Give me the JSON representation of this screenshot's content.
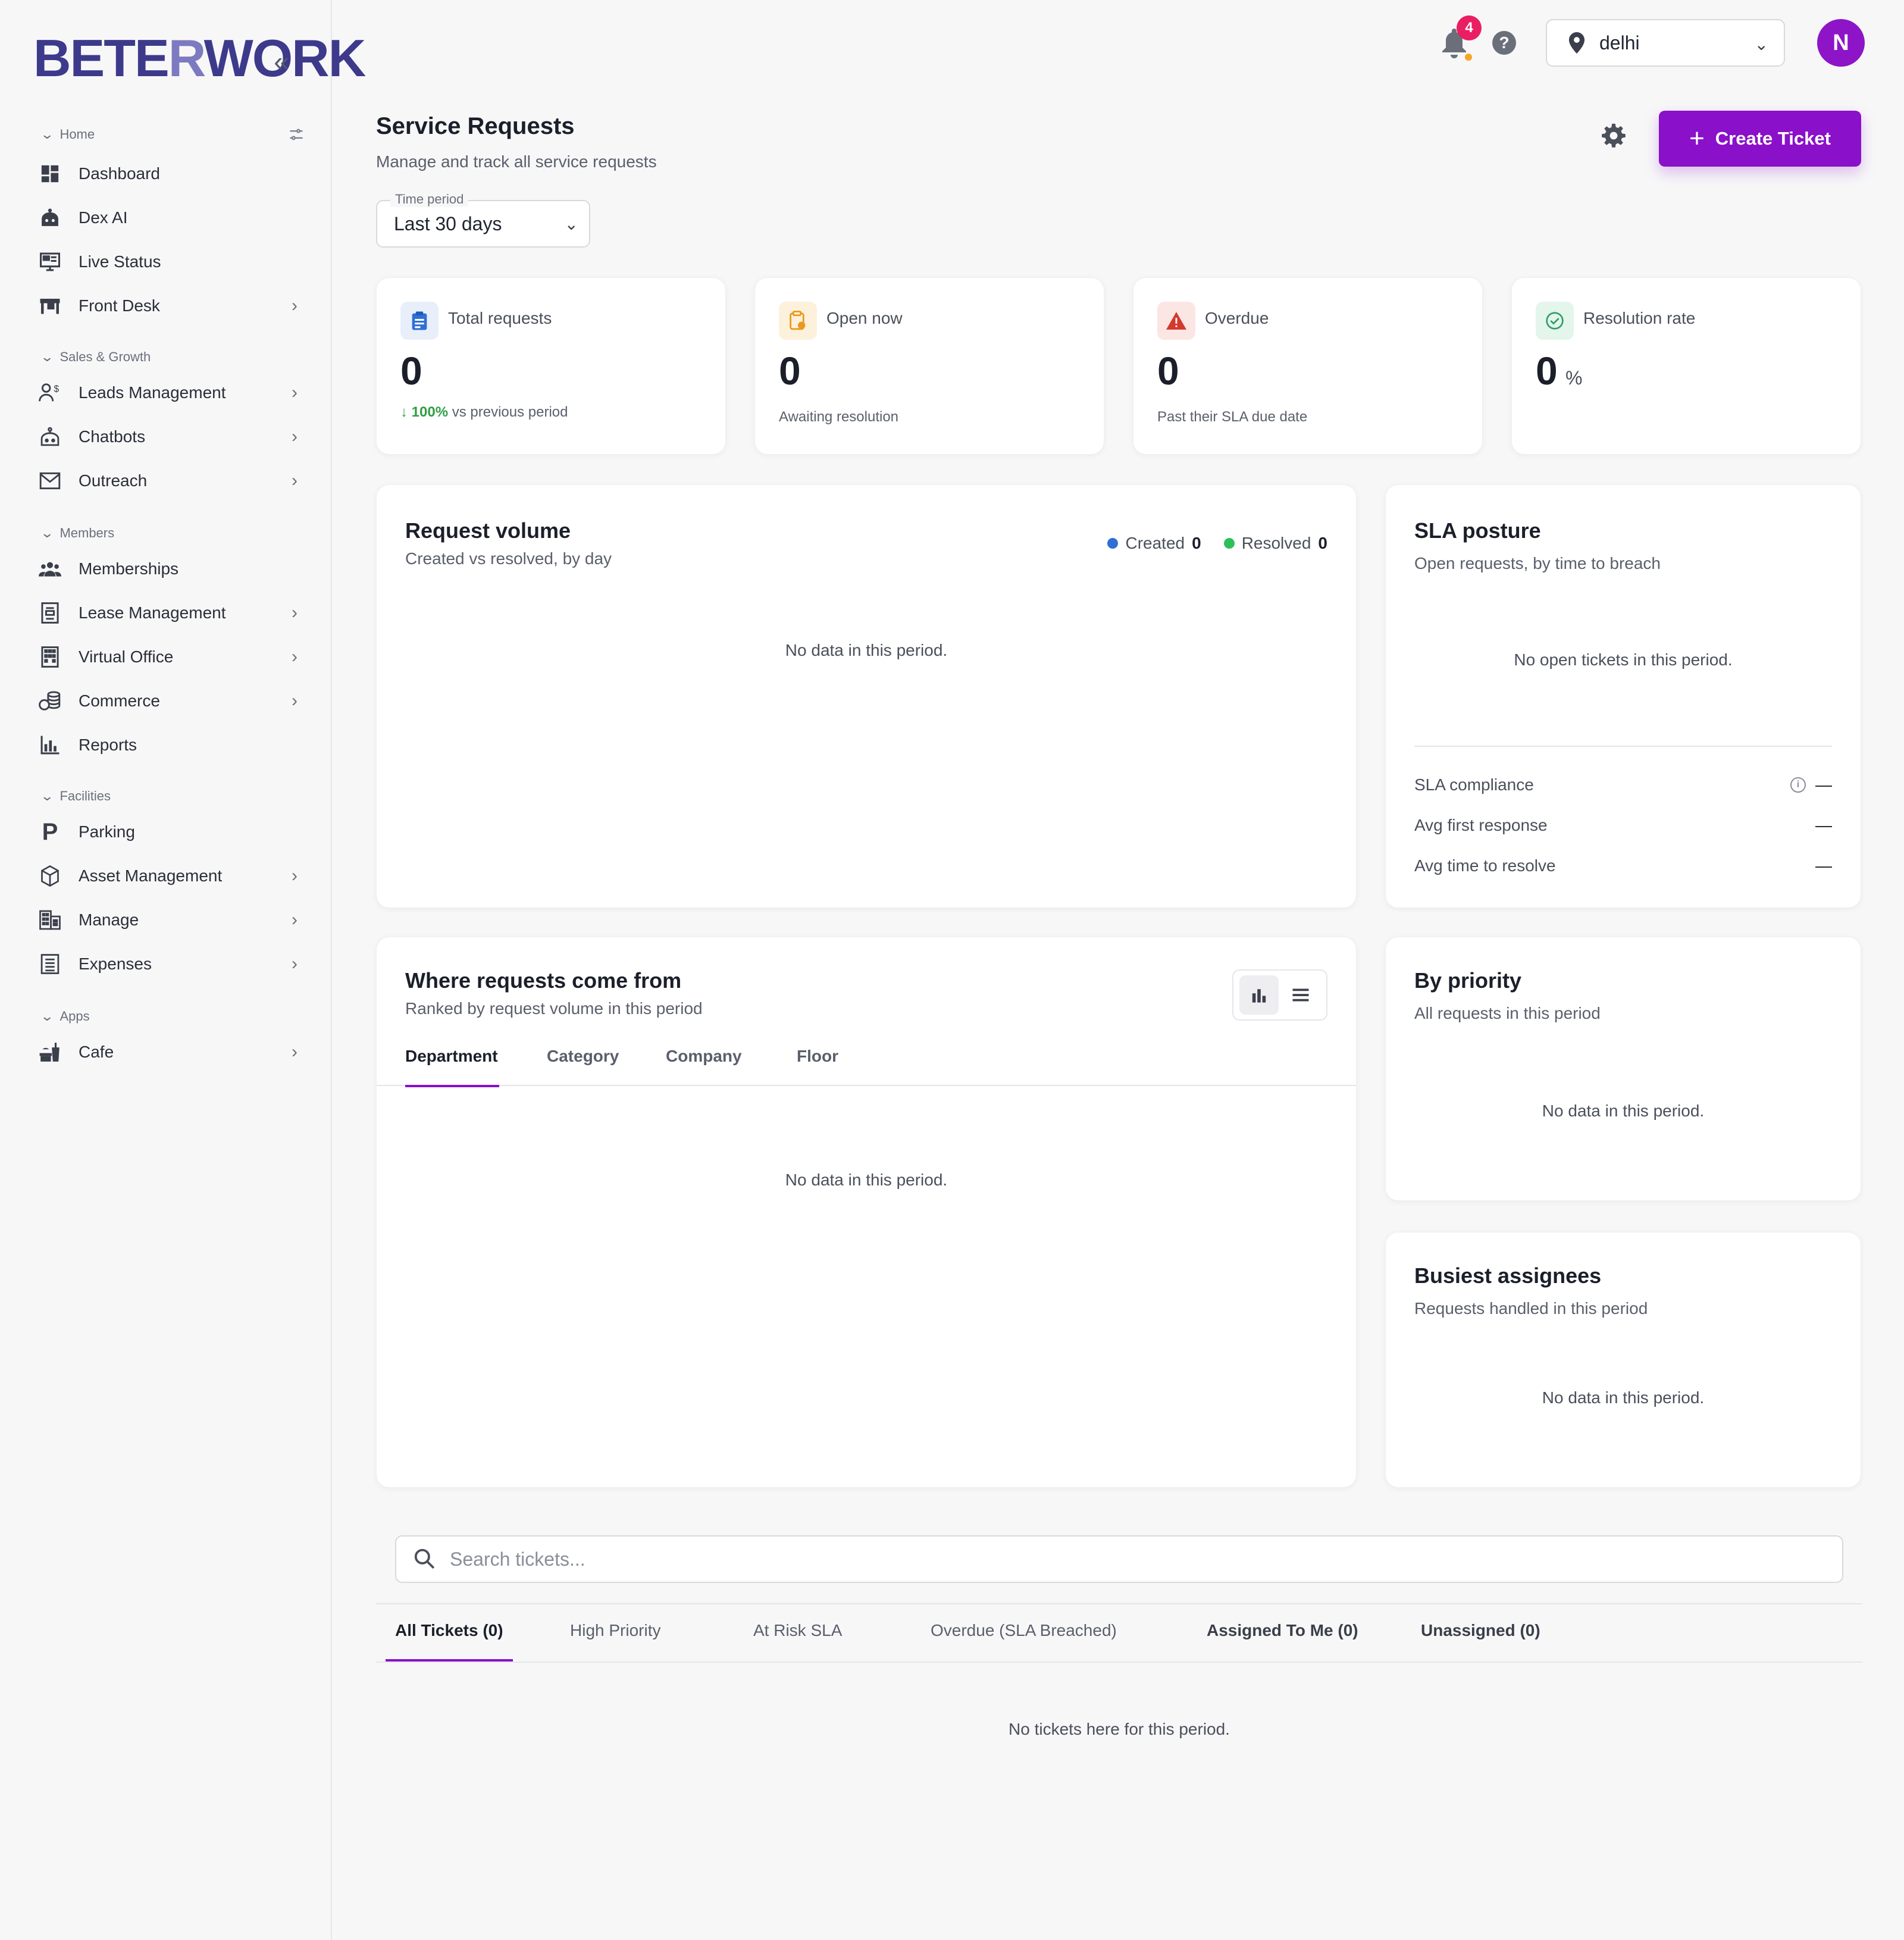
{
  "brand": {
    "logo_part1": "BETE",
    "logo_part2": "R",
    "logo_part3": "WORK",
    "primary_color": "#8a10c9"
  },
  "sidebar": {
    "sections": [
      {
        "label": "Home",
        "items": [
          {
            "label": "Dashboard",
            "icon": "dashboard-icon",
            "has_arrow": false
          },
          {
            "label": "Dex AI",
            "icon": "robot-icon",
            "has_arrow": false
          },
          {
            "label": "Live Status",
            "icon": "monitor-icon",
            "has_arrow": false
          },
          {
            "label": "Front Desk",
            "icon": "desk-icon",
            "has_arrow": true
          }
        ]
      },
      {
        "label": "Sales & Growth",
        "items": [
          {
            "label": "Leads Management",
            "icon": "people-dollar-icon",
            "has_arrow": true
          },
          {
            "label": "Chatbots",
            "icon": "chatbot-icon",
            "has_arrow": true
          },
          {
            "label": "Outreach",
            "icon": "mail-icon",
            "has_arrow": true
          }
        ]
      },
      {
        "label": "Members",
        "items": [
          {
            "label": "Memberships",
            "icon": "group-icon",
            "has_arrow": false
          },
          {
            "label": "Lease Management",
            "icon": "document-icon",
            "has_arrow": true
          },
          {
            "label": "Virtual Office",
            "icon": "building-icon",
            "has_arrow": true
          },
          {
            "label": "Commerce",
            "icon": "coins-icon",
            "has_arrow": true
          },
          {
            "label": "Reports",
            "icon": "bar-chart-icon",
            "has_arrow": false
          }
        ]
      },
      {
        "label": "Facilities",
        "items": [
          {
            "label": "Parking",
            "icon": "parking-icon",
            "has_arrow": false
          },
          {
            "label": "Asset Management",
            "icon": "cube-icon",
            "has_arrow": true
          },
          {
            "label": "Manage",
            "icon": "office-icon",
            "has_arrow": true
          },
          {
            "label": "Expenses",
            "icon": "receipt-icon",
            "has_arrow": true
          }
        ]
      },
      {
        "label": "Apps",
        "items": [
          {
            "label": "Cafe",
            "icon": "food-icon",
            "has_arrow": true
          }
        ]
      }
    ]
  },
  "topbar": {
    "notification_count": "4",
    "location": "delhi",
    "avatar_initial": "N"
  },
  "header": {
    "title": "Service Requests",
    "subtitle": "Manage and track all service requests",
    "create_label": "Create Ticket",
    "period_label": "Time period",
    "period_value": "Last 30 days"
  },
  "stats": [
    {
      "label": "Total requests",
      "value": "0",
      "trend_value": "100%",
      "trend_text": "vs previous period",
      "icon": "clipboard-icon",
      "icon_bg": "#e8effb",
      "icon_color": "#2f6fd6"
    },
    {
      "label": "Open now",
      "value": "0",
      "foot": "Awaiting resolution",
      "icon": "clipboard-clock-icon",
      "icon_bg": "#fdf1dc",
      "icon_color": "#e89a1c"
    },
    {
      "label": "Overdue",
      "value": "0",
      "foot": "Past their SLA due date",
      "icon": "warning-icon",
      "icon_bg": "#fbe6e4",
      "icon_color": "#d33a2c"
    },
    {
      "label": "Resolution rate",
      "value": "0",
      "unit": "%",
      "icon": "check-circle-icon",
      "icon_bg": "#e4f5ec",
      "icon_color": "#2f9e64"
    }
  ],
  "request_volume": {
    "title": "Request volume",
    "subtitle": "Created vs resolved, by day",
    "legend": [
      {
        "name": "Created",
        "value": "0",
        "color": "#2f6fd6"
      },
      {
        "name": "Resolved",
        "value": "0",
        "color": "#2fbf5a"
      }
    ],
    "empty": "No data in this period."
  },
  "sla": {
    "title": "SLA posture",
    "subtitle": "Open requests, by time to breach",
    "empty": "No open tickets in this period.",
    "rows": [
      {
        "label": "SLA compliance",
        "value": "—"
      },
      {
        "label": "Avg first response",
        "value": "—"
      },
      {
        "label": "Avg time to resolve",
        "value": "—"
      }
    ]
  },
  "sources": {
    "title": "Where requests come from",
    "subtitle": "Ranked by request volume in this period",
    "tabs": [
      "Department",
      "Category",
      "Company",
      "Floor"
    ],
    "empty": "No data in this period."
  },
  "priority": {
    "title": "By priority",
    "subtitle": "All requests in this period",
    "empty": "No data in this period."
  },
  "assignees": {
    "title": "Busiest assignees",
    "subtitle": "Requests handled in this period",
    "empty": "No data in this period."
  },
  "tickets": {
    "search_placeholder": "Search tickets...",
    "tabs": [
      "All Tickets (0)",
      "High Priority",
      "At Risk SLA",
      "Overdue (SLA Breached)",
      "Assigned To Me (0)",
      "Unassigned (0)"
    ],
    "empty": "No tickets here for this period."
  }
}
